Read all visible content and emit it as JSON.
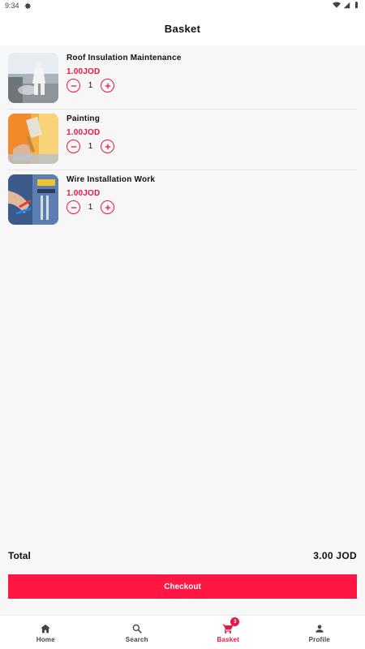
{
  "status_bar": {
    "time": "9:34",
    "icons": [
      "gear-icon",
      "wifi-icon",
      "signal-icon",
      "battery-icon"
    ]
  },
  "app_bar": {
    "title": "Basket"
  },
  "items": [
    {
      "name": "Roof Insulation Maintenance",
      "price": "1.00JOD",
      "quantity": "1",
      "image": "roof-insulation-photo"
    },
    {
      "name": "Painting",
      "price": "1.00JOD",
      "quantity": "1",
      "image": "painting-photo"
    },
    {
      "name": "Wire Installation Work",
      "price": "1.00JOD",
      "quantity": "1",
      "image": "wire-installation-photo"
    }
  ],
  "summary": {
    "total_label": "Total",
    "total_value": "3.00 JOD"
  },
  "checkout": {
    "label": "Checkout"
  },
  "bottom_nav": {
    "items": [
      {
        "label": "Home",
        "icon": "home-icon"
      },
      {
        "label": "Search",
        "icon": "search-icon"
      },
      {
        "label": "Basket",
        "icon": "cart-icon",
        "badge": "3",
        "active": true
      },
      {
        "label": "Profile",
        "icon": "person-icon"
      }
    ]
  },
  "colors": {
    "accent": "#e8173f",
    "button": "#ff1744",
    "background": "#f7f7f7"
  }
}
